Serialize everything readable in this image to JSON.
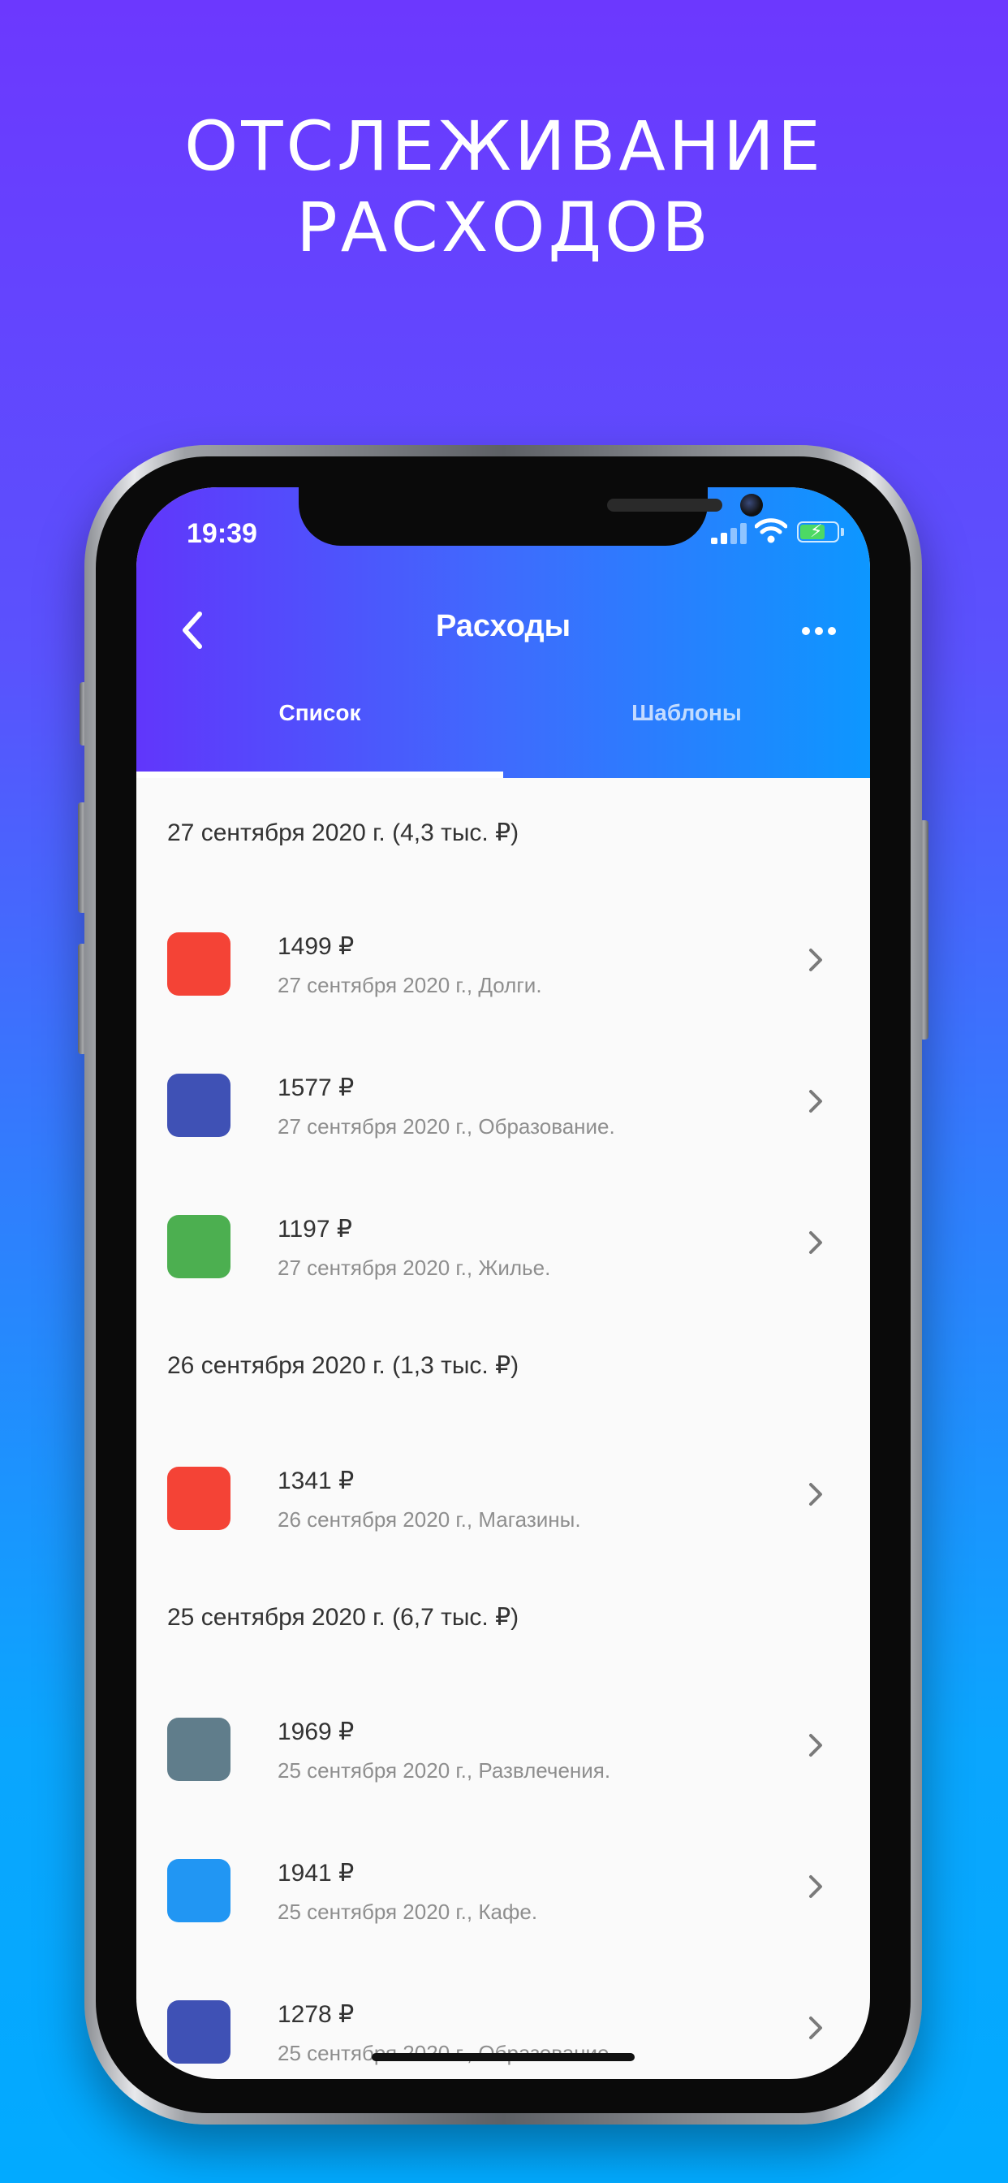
{
  "headline": {
    "line1": "ОТСЛЕЖИВАНИЕ",
    "line2": "РАСХОДОВ"
  },
  "status_bar": {
    "time": "19:39"
  },
  "header": {
    "title": "Расходы",
    "tabs": [
      {
        "label": "Список",
        "selected": true
      },
      {
        "label": "Шаблоны",
        "selected": false
      }
    ]
  },
  "groups": [
    {
      "title": "27 сентября 2020 г. (4,3 тыс. ₽)",
      "items": [
        {
          "amount": "1499 ₽",
          "meta": "27 сентября 2020 г., Долги.",
          "color": "#f44336"
        },
        {
          "amount": "1577 ₽",
          "meta": "27 сентября 2020 г., Образование.",
          "color": "#3f51b5"
        },
        {
          "amount": "1197 ₽",
          "meta": "27 сентября 2020 г., Жилье.",
          "color": "#4caf50"
        }
      ]
    },
    {
      "title": "26 сентября 2020 г. (1,3 тыс. ₽)",
      "items": [
        {
          "amount": "1341 ₽",
          "meta": "26 сентября 2020 г., Магазины.",
          "color": "#f44336"
        }
      ]
    },
    {
      "title": "25 сентября 2020 г. (6,7 тыс. ₽)",
      "items": [
        {
          "amount": "1969 ₽",
          "meta": "25 сентября 2020 г., Развлечения.",
          "color": "#607d8b"
        },
        {
          "amount": "1941 ₽",
          "meta": "25 сентября 2020 г., Кафе.",
          "color": "#2196f3"
        },
        {
          "amount": "1278 ₽",
          "meta": "25 сентября 2020 г., Образование.",
          "color": "#3f51b5"
        }
      ]
    }
  ],
  "colors": {
    "background_top": "#6c38fe",
    "background_bottom": "#02aaff",
    "header_start": "#6136fb",
    "header_end": "#0d97ff"
  }
}
